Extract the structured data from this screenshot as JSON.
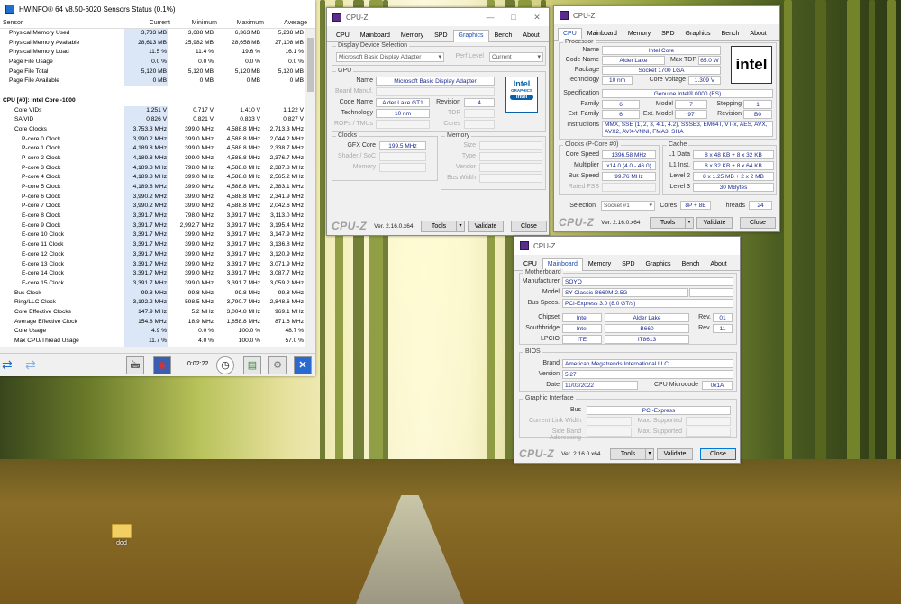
{
  "desktop": {
    "icon_label": "ddd"
  },
  "hwinfo": {
    "title": "HWiNFO® 64 v8.50-6020 Sensors Status (0.1%)",
    "columns": [
      "Sensor",
      "Current",
      "Minimum",
      "Maximum",
      "Average"
    ],
    "rows": [
      [
        "Physical Memory Used",
        "3,733 MB",
        "3,688 MB",
        "6,363 MB",
        "5,238 MB"
      ],
      [
        "Physical Memory Available",
        "28,613 MB",
        "25,982 MB",
        "28,658 MB",
        "27,108 MB"
      ],
      [
        "Physical Memory Load",
        "11.5 %",
        "11.4 %",
        "19.6 %",
        "16.1 %"
      ],
      [
        "Page File Usage",
        "0.0 %",
        "0.0 %",
        "0.0 %",
        "0.0 %"
      ],
      [
        "Page File Total",
        "5,120 MB",
        "5,120 MB",
        "5,120 MB",
        "5,120 MB"
      ],
      [
        "Page File Available",
        "0 MB",
        "0 MB",
        "0 MB",
        "0 MB"
      ],
      [
        "",
        "",
        "",
        "",
        ""
      ],
      [
        "CPU [#0]: Intel Core -1000",
        "",
        "",
        "",
        ""
      ],
      [
        "Core VIDs",
        "1.251 V",
        "0.717 V",
        "1.410 V",
        "1.122 V"
      ],
      [
        "SA VID",
        "0.826 V",
        "0.821 V",
        "0.833 V",
        "0.827 V"
      ],
      [
        "Core Clocks",
        "3,753.3 MHz",
        "399.0 MHz",
        "4,588.8 MHz",
        "2,713.3 MHz"
      ],
      [
        "P-core 0 Clock",
        "3,990.2 MHz",
        "399.0 MHz",
        "4,588.8 MHz",
        "2,044.2 MHz"
      ],
      [
        "P-core 1 Clock",
        "4,189.8 MHz",
        "399.0 MHz",
        "4,588.8 MHz",
        "2,338.7 MHz"
      ],
      [
        "P-core 2 Clock",
        "4,189.8 MHz",
        "399.0 MHz",
        "4,588.8 MHz",
        "2,376.7 MHz"
      ],
      [
        "P-core 3 Clock",
        "4,189.8 MHz",
        "798.0 MHz",
        "4,588.8 MHz",
        "2,387.8 MHz"
      ],
      [
        "P-core 4 Clock",
        "4,189.8 MHz",
        "399.0 MHz",
        "4,588.8 MHz",
        "2,565.2 MHz"
      ],
      [
        "P-core 5 Clock",
        "4,189.8 MHz",
        "399.0 MHz",
        "4,588.8 MHz",
        "2,383.1 MHz"
      ],
      [
        "P-core 6 Clock",
        "3,990.2 MHz",
        "399.0 MHz",
        "4,588.8 MHz",
        "2,341.9 MHz"
      ],
      [
        "P-core 7 Clock",
        "3,990.2 MHz",
        "399.0 MHz",
        "4,588.8 MHz",
        "2,042.6 MHz"
      ],
      [
        "E-core 8 Clock",
        "3,391.7 MHz",
        "798.0 MHz",
        "3,391.7 MHz",
        "3,113.0 MHz"
      ],
      [
        "E-core 9 Clock",
        "3,391.7 MHz",
        "2,992.7 MHz",
        "3,391.7 MHz",
        "3,195.4 MHz"
      ],
      [
        "E-core 10 Clock",
        "3,391.7 MHz",
        "399.0 MHz",
        "3,391.7 MHz",
        "3,147.9 MHz"
      ],
      [
        "E-core 11 Clock",
        "3,391.7 MHz",
        "399.0 MHz",
        "3,391.7 MHz",
        "3,136.8 MHz"
      ],
      [
        "E-core 12 Clock",
        "3,391.7 MHz",
        "399.0 MHz",
        "3,391.7 MHz",
        "3,120.9 MHz"
      ],
      [
        "E-core 13 Clock",
        "3,391.7 MHz",
        "399.0 MHz",
        "3,391.7 MHz",
        "3,071.9 MHz"
      ],
      [
        "E-core 14 Clock",
        "3,391.7 MHz",
        "399.0 MHz",
        "3,391.7 MHz",
        "3,087.7 MHz"
      ],
      [
        "E-core 15 Clock",
        "3,391.7 MHz",
        "399.0 MHz",
        "3,391.7 MHz",
        "3,059.2 MHz"
      ],
      [
        "Bus Clock",
        "99.8 MHz",
        "99.8 MHz",
        "99.8 MHz",
        "99.8 MHz"
      ],
      [
        "Ring/LLC Clock",
        "3,192.2 MHz",
        "598.5 MHz",
        "3,790.7 MHz",
        "2,848.6 MHz"
      ],
      [
        "Core Effective Clocks",
        "147.9 MHz",
        "5.2 MHz",
        "3,004.8 MHz",
        "969.1 MHz"
      ],
      [
        "Average Effective Clock",
        "154.8 MHz",
        "18.9 MHz",
        "1,858.8 MHz",
        "871.6 MHz"
      ],
      [
        "Core Usage",
        "4.9 %",
        "0.0 %",
        "100.0 %",
        "48.7 %"
      ],
      [
        "Max CPU/Thread Usage",
        "11.7 %",
        "4.0 %",
        "100.0 %",
        "57.0 %"
      ]
    ],
    "timer": "0:02:22"
  },
  "cpuz_gfx": {
    "title": "CPU-Z",
    "tabs": [
      "CPU",
      "Mainboard",
      "Memory",
      "SPD",
      "Graphics",
      "Bench",
      "About"
    ],
    "display_device_selection": "Display Device Selection",
    "device": "Microsoft Basic Display Adapter",
    "perf_level_label": "Perf Level",
    "perf_level": "Current",
    "gpu_group": "GPU",
    "name_label": "Name",
    "name": "Microsoft Basic Display Adapter",
    "board_label": "Board Manuf.",
    "code_label": "Code Name",
    "code": "Alder Lake GT1",
    "revision_label": "Revision",
    "revision": "4",
    "tech_label": "Technology",
    "tech": "10 nm",
    "tdp_label": "TDP",
    "rops_label": "ROPs / TMUs",
    "cores_label": "Cores",
    "clocks_group": "Clocks",
    "gfx_core_label": "GFX Core",
    "gfx_core": "199.5 MHz",
    "shader_label": "Shader / SoC",
    "memory_label": "Memory",
    "memory_group": "Memory",
    "size_label": "Size",
    "type_label": "Type",
    "vendor_label": "Vendor",
    "buswidth_label": "Bus Width",
    "logo": [
      "Intel",
      "GRAPHICS",
      "intel"
    ]
  },
  "cpuz_cpu": {
    "title": "CPU-Z",
    "tabs": [
      "CPU",
      "Mainboard",
      "Memory",
      "SPD",
      "Graphics",
      "Bench",
      "About"
    ],
    "processor_group": "Processor",
    "name_label": "Name",
    "name": "Intel Core",
    "code_label": "Code Name",
    "code": "Alder Lake",
    "maxtdp_label": "Max TDP",
    "maxtdp": "65.0 W",
    "package_label": "Package",
    "package": "Socket 1700 LGA",
    "tech_label": "Technology",
    "tech": "10 nm",
    "cv_label": "Core Voltage",
    "cv": "1.309 V",
    "spec_label": "Specification",
    "spec": "Genuine Intel® 0000 (ES)",
    "family_label": "Family",
    "family": "6",
    "model_label": "Model",
    "model": "7",
    "stepping_label": "Stepping",
    "stepping": "1",
    "extfam_label": "Ext. Family",
    "extfam": "6",
    "extmodel_label": "Ext. Model",
    "extmodel": "97",
    "rev_label": "Revision",
    "rev": "B0",
    "instr_label": "Instructions",
    "instr": "MMX, SSE (1, 2, 3, 4.1, 4.2), SSSE3, EM64T, VT-x, AES, AVX, AVX2, AVX-VNNI, FMA3, SHA",
    "clocks_group": "Clocks (P-Core #0)",
    "cs_label": "Core Speed",
    "cs": "1396.58 MHz",
    "mult_label": "Multiplier",
    "mult": "x14.0 (4.0 - 46.0)",
    "bus_label": "Bus Speed",
    "bus": "99.76 MHz",
    "fsb_label": "Rated FSB",
    "cache_group": "Cache",
    "l1d_label": "L1 Data",
    "l1d": "8 x 48 KB + 8 x 32 KB",
    "l1i_label": "L1 Inst.",
    "l1i": "8 x 32 KB + 8 x 64 KB",
    "l2_label": "Level 2",
    "l2": "8 x 1.25 MB + 2 x 2 MB",
    "l3_label": "Level 3",
    "l3": "30 MBytes",
    "selection_label": "Selection",
    "selection": "Socket #1",
    "cores_label": "Cores",
    "cores": "8P + 8E",
    "threads_label": "Threads",
    "threads": "24",
    "logo": "intel"
  },
  "cpuz_mb": {
    "title": "CPU-Z",
    "tabs": [
      "CPU",
      "Mainboard",
      "Memory",
      "SPD",
      "Graphics",
      "Bench",
      "About"
    ],
    "mb_group": "Motherboard",
    "manu_label": "Manufacturer",
    "manu": "SOYO",
    "model_label": "Model",
    "model": "SY-Classic B660M 2.5G",
    "busspec_label": "Bus Specs.",
    "busspec": "PCI-Express 3.0 (8.0 GT/s)",
    "chipset_label": "Chipset",
    "chipset": "Intel",
    "chipset2": "Alder Lake",
    "chipset_rev": "01",
    "south_label": "Southbridge",
    "south": "Intel",
    "south2": "B660",
    "south_rev": "11",
    "lpcio_label": "LPCIO",
    "lpcio": "ITE",
    "lpcio2": "IT8613",
    "rev_label": "Rev.",
    "bios_group": "BIOS",
    "brand_label": "Brand",
    "brand": "American Megatrends International LLC.",
    "version_label": "Version",
    "version": "5.27",
    "date_label": "Date",
    "date": "11/03/2022",
    "micro_label": "CPU Microcode",
    "micro": "0x1A",
    "gi_group": "Graphic Interface",
    "gbus_label": "Bus",
    "gbus": "PCI-Express",
    "clw_label": "Current Link Width",
    "ms1_label": "Max. Supported",
    "sba_label": "Side Band Addressing",
    "ms2_label": "Max. Supported"
  },
  "cpuz_common": {
    "brand": "CPU-Z",
    "version": "Ver. 2.16.0.x64",
    "tools": "Tools",
    "validate": "Validate",
    "close": "Close"
  }
}
